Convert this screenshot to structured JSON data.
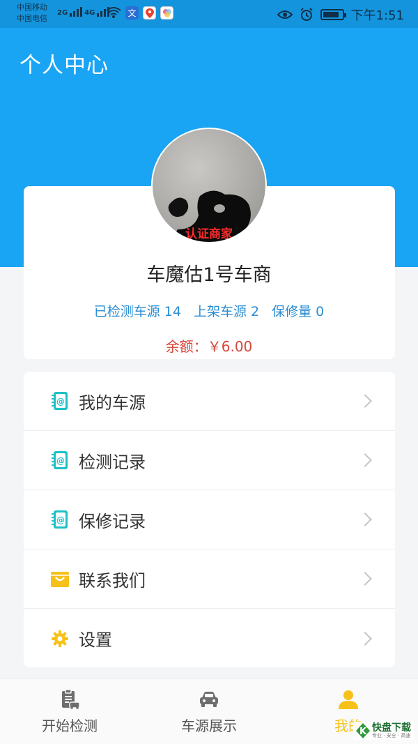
{
  "status_bar": {
    "carrier_1": "中国移动",
    "carrier_2": "中国电信",
    "net_1": "2G",
    "net_2": "4G",
    "time": "下午1:51",
    "battery_level": 0.85
  },
  "header": {
    "title": "个人中心"
  },
  "profile": {
    "cert_label": "认证商家",
    "name": "车魔估1号车商",
    "stats": [
      "已检测车源 14",
      "上架车源 2",
      "保修量 0"
    ],
    "balance": "余额：￥6.00"
  },
  "menu": {
    "items": [
      {
        "label": "我的车源",
        "icon": "contact-book-icon"
      },
      {
        "label": "检测记录",
        "icon": "contact-book-icon"
      },
      {
        "label": "保修记录",
        "icon": "contact-book-icon"
      },
      {
        "label": "联系我们",
        "icon": "shopping-bag-icon"
      },
      {
        "label": "设置",
        "icon": "gear-icon"
      }
    ]
  },
  "bottom_nav": {
    "items": [
      {
        "label": "开始检测",
        "icon": "clipboard-car-icon"
      },
      {
        "label": "车源展示",
        "icon": "car-icon"
      },
      {
        "label": "我的",
        "icon": "person-icon",
        "active": true
      }
    ]
  },
  "watermark": {
    "logo_glyph": "K",
    "title": "快盘下载",
    "subtitle": "专业 · 安全 · 高速"
  },
  "colors": {
    "primary": "#1aa4f4",
    "accent": "#f6c11a",
    "stats_text": "#2a8dd3",
    "balance_text": "#d6463a",
    "cert_text": "#ff2a2a"
  }
}
